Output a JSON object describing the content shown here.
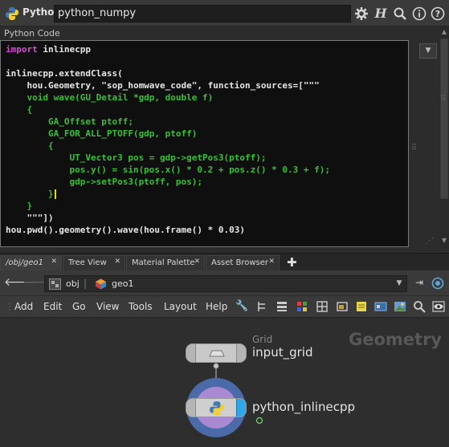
{
  "header": {
    "node_type": "Python",
    "node_name": "python_numpy",
    "icons": [
      "python-icon",
      "gear-icon",
      "help-h-icon",
      "search-icon",
      "info-icon",
      "help-icon"
    ]
  },
  "code_panel": {
    "label": "Python Code",
    "lines": [
      "import inlinecpp",
      "",
      "inlinecpp.extendClass(",
      "    hou.Geometry, \"sop_homwave_code\", function_sources=[\"\"\"",
      "    void wave(GU_Detail *gdp, double f)",
      "    {",
      "        GA_Offset ptoff;",
      "        GA_FOR_ALL_PTOFF(gdp, ptoff)",
      "        {",
      "            UT_Vector3 pos = gdp->getPos3(ptoff);",
      "            pos.y() = sin(pos.x() * 0.2 + pos.z() * 0.3 + f);",
      "            gdp->setPos3(ptoff, pos);",
      "        }",
      "    }",
      "    \"\"\"])",
      "hou.pwd().geometry().wave(hou.frame() * 0.03)"
    ],
    "colors": {
      "keyword": "#d64bd6",
      "cpp_code": "#35c235",
      "python_text": "#e6e6e6"
    }
  },
  "tabs": [
    {
      "label": "/obj/geo1",
      "active": true
    },
    {
      "label": "Tree View",
      "active": false
    },
    {
      "label": "Material Palette",
      "active": false
    },
    {
      "label": "Asset Browser",
      "active": false
    }
  ],
  "path": {
    "segments": [
      "obj",
      "geo1"
    ]
  },
  "menu": [
    "Add",
    "Edit",
    "Go",
    "View",
    "Tools",
    "Layout",
    "Help"
  ],
  "network": {
    "context_label": "Geometry",
    "nodes": [
      {
        "name": "input_grid",
        "type_label": "Grid"
      },
      {
        "name": "python_inlinecpp",
        "type_label": ""
      }
    ]
  }
}
